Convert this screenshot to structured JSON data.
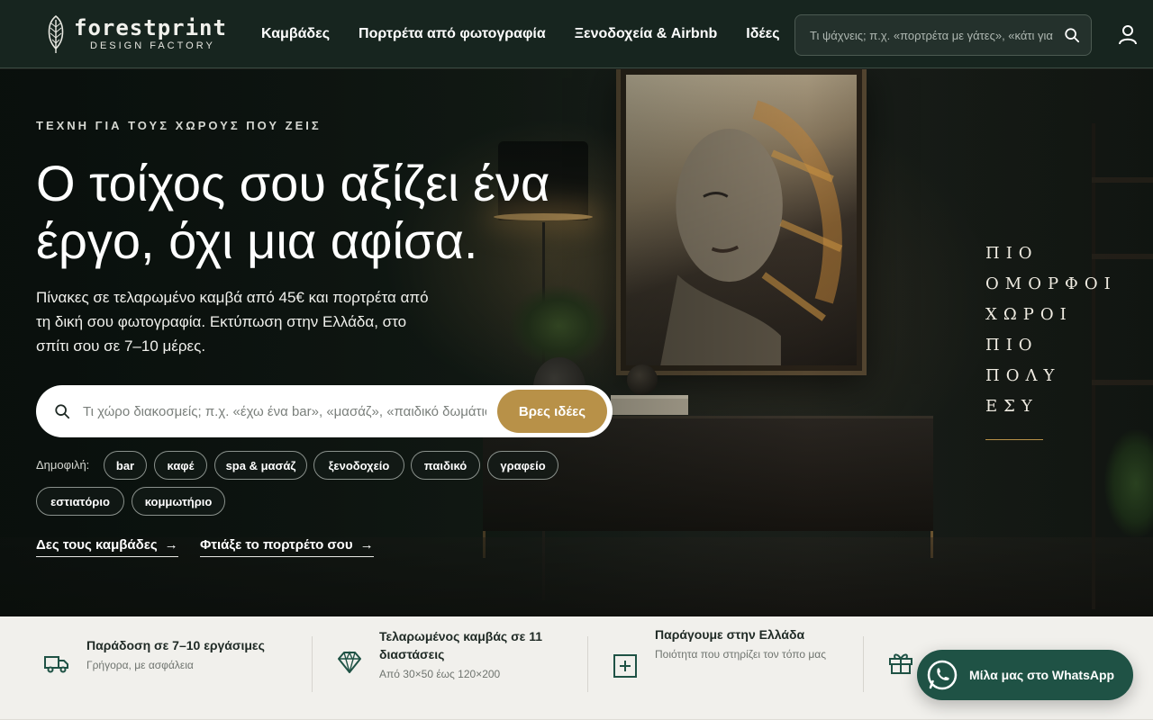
{
  "header": {
    "logo_name": "forestprint",
    "logo_sub": "DESIGN FACTORY",
    "nav": [
      {
        "label": "Καμβάδες"
      },
      {
        "label": "Πορτρέτα από φωτογραφία"
      },
      {
        "label": "Ξενοδοχεία & Airbnb"
      },
      {
        "label": "Ιδέες"
      }
    ],
    "search_placeholder": "Τι ψάχνεις; π.χ. «πορτρέτα με γάτες», «κάτι για σαλόνι»"
  },
  "hero": {
    "eyebrow": "ΤΕΧΝΗ ΓΙΑ ΤΟΥΣ ΧΩΡΟΥΣ ΠΟΥ ΖΕΙΣ",
    "title": "Ο τοίχος σου αξίζει ένα έργο, όχι μια αφίσα.",
    "subtitle": "Πίνακες σε τελαρωμένο καμβά από 45€ και πορτρέτα από τη δική σου φωτογραφία. Εκτύπωση στην Ελλάδα, στο σπίτι σου σε 7–10 μέρες.",
    "search_placeholder": "Τι χώρο διακοσμείς; π.χ. «έχω ένα bar», «μασάζ», «παιδικό δωμάτιο»",
    "search_button": "Βρες ιδέες",
    "popular_label": "Δημοφιλή:",
    "chips": [
      "bar",
      "καφέ",
      "spa & μασάζ",
      "ξενοδοχείο",
      "παιδικό",
      "γραφείο",
      "εστιατόριο",
      "κομμωτήριο"
    ],
    "cta_canvases": "Δες τους καμβάδες",
    "cta_portrait": "Φτιάξε το πορτρέτο σου",
    "vertical_lines": [
      "ΠΙΟ",
      "ΟΜΟΡΦΟΙ",
      "ΧΩΡΟΙ",
      "ΠΙΟ",
      "ΠΟΛΥ",
      "ΕΣΥ"
    ]
  },
  "features": [
    {
      "icon": "truck-icon",
      "title": "Παράδοση σε 7–10 εργάσιμες",
      "subtitle": "Γρήγορα, με ασφάλεια"
    },
    {
      "icon": "diamond-icon",
      "title": "Τελαρωμένος καμβάς σε 11 διαστάσεις",
      "subtitle": "Από 30×50 έως 120×200"
    },
    {
      "icon": "plus-square-icon",
      "title": "Παράγουμε στην Ελλάδα",
      "subtitle": "Ποιότητα που στηρίζει τον τόπο μας"
    },
    {
      "icon": "gift-icon",
      "title": "",
      "subtitle": ""
    }
  ],
  "whatsapp": {
    "label": "Μίλα μας στο WhatsApp"
  },
  "colors": {
    "header_bg": "#17251f",
    "accent_gold": "#b89148",
    "whatsapp_green": "#1f5245",
    "features_bg": "#f1f0ec"
  }
}
